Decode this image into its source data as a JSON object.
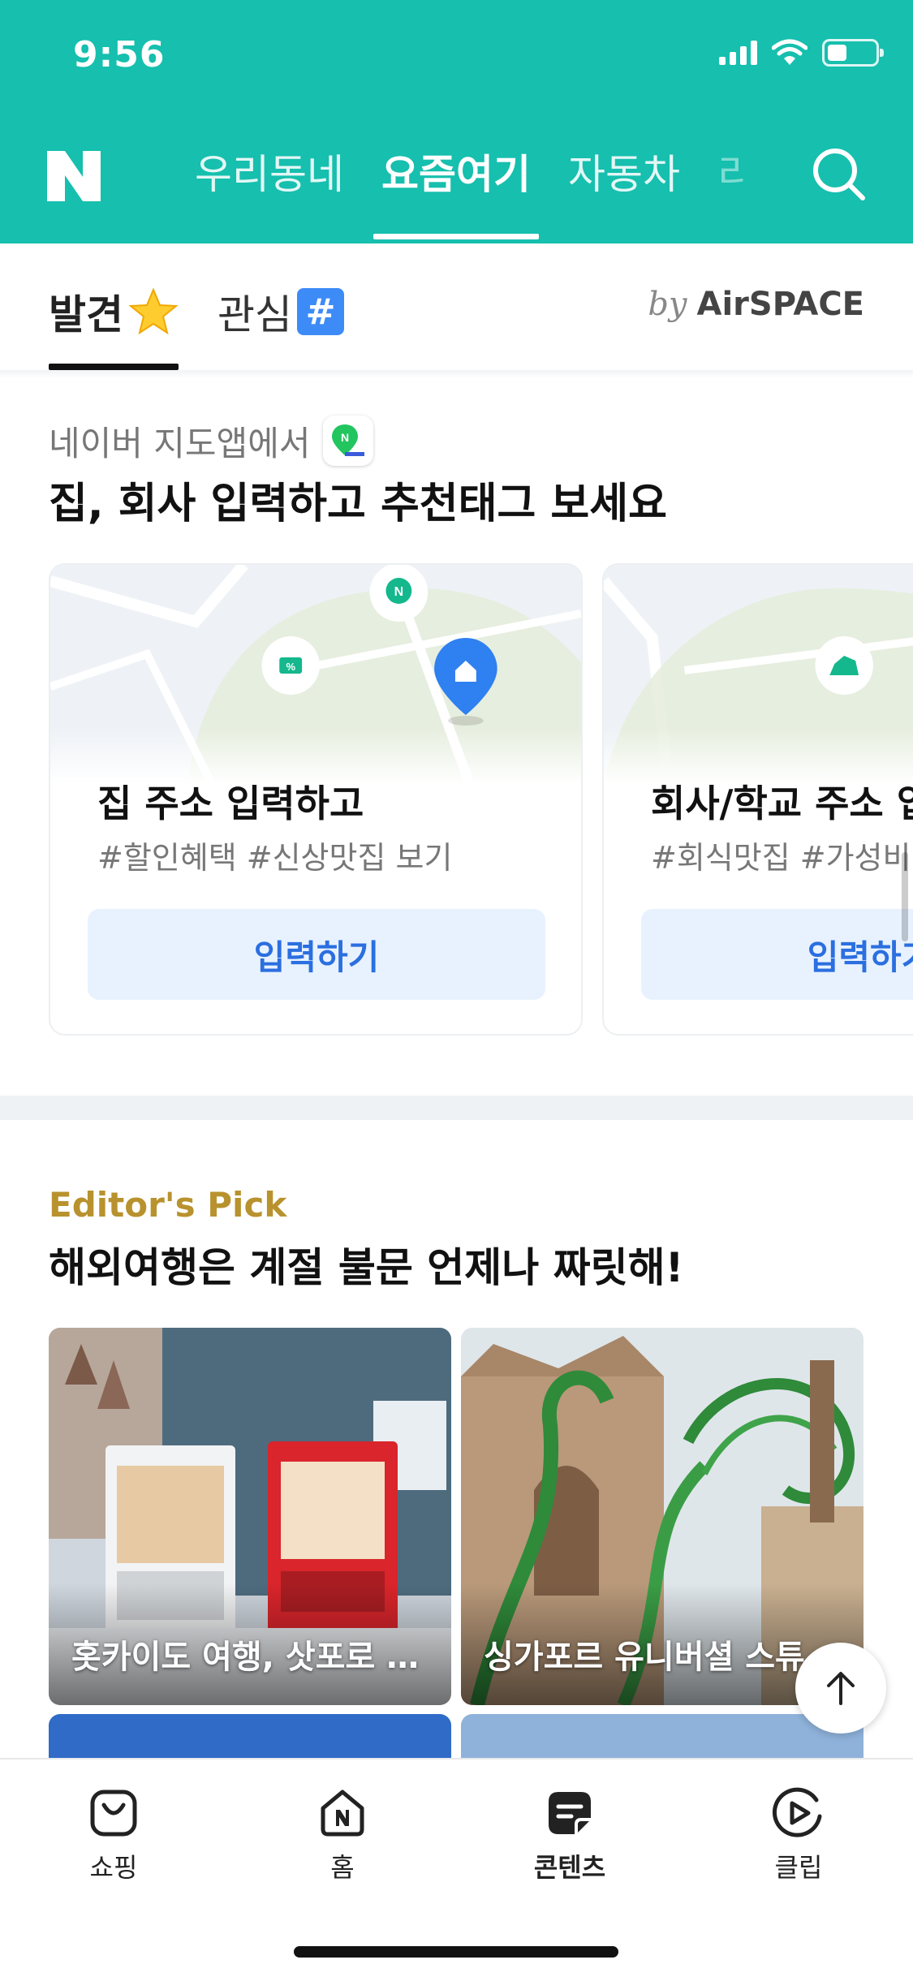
{
  "status_bar": {
    "time": "9:56"
  },
  "header": {
    "tabs": [
      {
        "label": "우리동네"
      },
      {
        "label": "요즘여기"
      },
      {
        "label": "자동차"
      },
      {
        "label": "리"
      }
    ],
    "active_tab": "요즘여기"
  },
  "subtabs": {
    "items": [
      {
        "label": "발견"
      },
      {
        "label": "관심"
      }
    ],
    "hash_symbol": "#",
    "by_label": "by",
    "brand": "AirSPACE"
  },
  "map_section": {
    "caption": "네이버 지도앱에서",
    "title": "집, 회사 입력하고 추천태그 보세요",
    "cards": [
      {
        "title": "집 주소 입력하고",
        "tags": "#할인혜택 #신상맛집 보기",
        "button": "입력하기"
      },
      {
        "title": "회사/학교 주소 입력하고",
        "tags": "#회식맛집 #가성비카페",
        "button": "입력하기"
      }
    ]
  },
  "editors_pick": {
    "label": "Editor's Pick",
    "title": "해외여행은 계절 불문 언제나 짜릿해!",
    "tiles": [
      {
        "caption": "홋카이도 여행, 삿포로 …"
      },
      {
        "caption": "싱가포르 유니버셜 스튜"
      }
    ]
  },
  "bottom_nav": {
    "items": [
      {
        "label": "쇼핑",
        "icon": "shopping-bag-icon"
      },
      {
        "label": "홈",
        "icon": "home-icon"
      },
      {
        "label": "콘텐츠",
        "icon": "contents-icon"
      },
      {
        "label": "클립",
        "icon": "clip-play-icon"
      }
    ],
    "active": "콘텐츠"
  },
  "colors": {
    "brand_green": "#16bfae",
    "button_blue": "#2b6fe0",
    "editor_gold": "#b8922e"
  }
}
